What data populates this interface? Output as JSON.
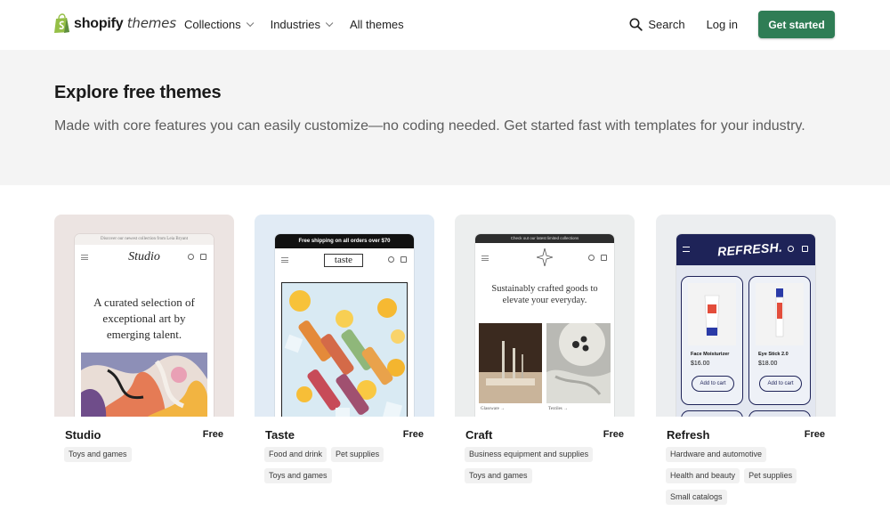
{
  "header": {
    "logo_bold": "shopify",
    "logo_italic": "themes",
    "nav": [
      {
        "label": "Collections",
        "has_dropdown": true
      },
      {
        "label": "Industries",
        "has_dropdown": true
      },
      {
        "label": "All themes",
        "has_dropdown": false
      }
    ],
    "search_label": "Search",
    "login_label": "Log in",
    "cta_label": "Get started",
    "cta_color": "#2f7d55"
  },
  "hero": {
    "title": "Explore free themes",
    "subtitle": "Made with core features you can easily customize—no coding needed. Get started fast with templates for your industry."
  },
  "themes": [
    {
      "name": "Studio",
      "price": "Free",
      "tags": [
        "Toys and games"
      ],
      "bg": "#ece4e2",
      "preview": {
        "promo": "Discover our newest collection from Leia Bryant",
        "logo": "Studio",
        "headline": "A curated selection of exceptional art by emerging talent."
      }
    },
    {
      "name": "Taste",
      "price": "Free",
      "tags": [
        "Food and drink",
        "Pet supplies",
        "Toys and games"
      ],
      "bg": "#e1ebf5",
      "preview": {
        "promo": "Free shipping on all orders over $70",
        "logo": "taste"
      }
    },
    {
      "name": "Craft",
      "price": "Free",
      "tags": [
        "Business equipment and supplies",
        "Toys and games"
      ],
      "bg": "#eceeee",
      "preview": {
        "promo": "Check out our latest limited collections",
        "headline": "Sustainably crafted goods to elevate your everyday.",
        "link_a": "Glassware →",
        "link_b": "Textiles →"
      }
    },
    {
      "name": "Refresh",
      "price": "Free",
      "tags": [
        "Hardware and automotive",
        "Health and beauty",
        "Pet supplies",
        "Small catalogs"
      ],
      "bg": "#eceef0",
      "preview": {
        "logo": "REFRESH.",
        "products": [
          {
            "name": "Face Moisturizer",
            "price": "$16.00",
            "button": "Add to cart"
          },
          {
            "name": "Eye Stick 2.0",
            "price": "$18.00",
            "button": "Add to cart"
          }
        ]
      }
    }
  ]
}
